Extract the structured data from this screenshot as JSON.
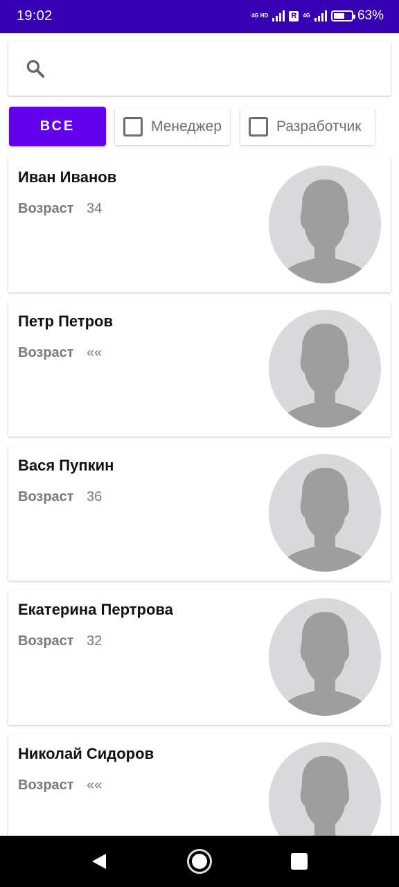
{
  "status_bar": {
    "time": "19:02",
    "network_1": "4G HD",
    "roaming": "R",
    "network_2": "4G",
    "battery_percent_text": "63%",
    "battery_level": 0.63
  },
  "search": {
    "placeholder": "",
    "value": ""
  },
  "filters": {
    "all_label": "ВСЕ",
    "manager_label": "Менеджер",
    "manager_checked": false,
    "developer_label": "Разработчик",
    "developer_checked": false
  },
  "employees": [
    {
      "name": "Иван Иванов",
      "age_label": "Возраст",
      "age": "34"
    },
    {
      "name": "Петр Петров",
      "age_label": "Возраст",
      "age": "««"
    },
    {
      "name": "Вася Пупкин",
      "age_label": "Возраст",
      "age": "36"
    },
    {
      "name": "Екатерина Пертрова",
      "age_label": "Возраст",
      "age": "32"
    },
    {
      "name": "Николай Сидоров",
      "age_label": "Возраст",
      "age": "««"
    }
  ],
  "colors": {
    "status_bar": "#3700b3",
    "primary": "#6200ee",
    "avatar_bg": "#d9d9dc",
    "avatar_fg": "#9e9e9e"
  }
}
